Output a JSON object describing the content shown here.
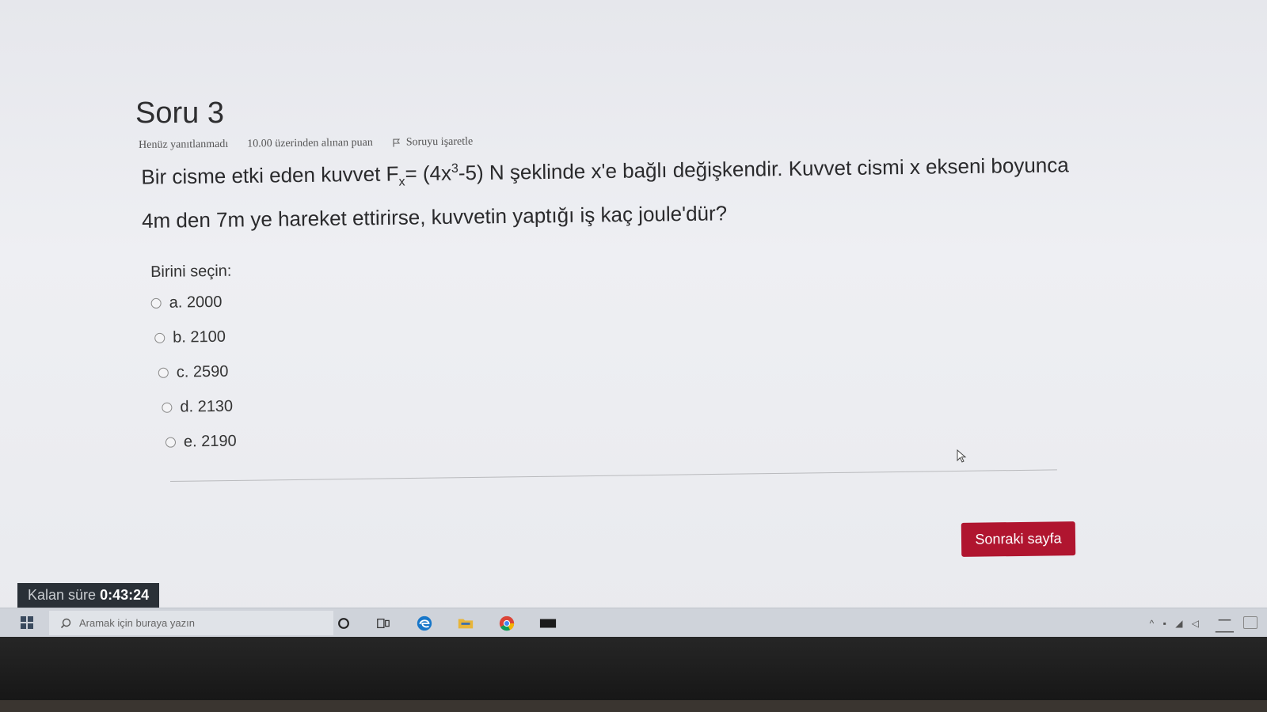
{
  "question": {
    "title": "Soru 3",
    "status": "Henüz yanıtlanmadı",
    "grade_info": "10.00 üzerinden alınan puan",
    "flag_label": "Soruyu işaretle",
    "text_part1": "Bir cisme etki eden kuvvet F",
    "text_sub": "x",
    "text_part2": "= (4x",
    "text_sup": "3",
    "text_part3": "-5) N şeklinde x'e bağlı değişkendir. Kuvvet cismi x ekseni boyunca 4m den 7m ye hareket ettirirse, kuvvetin yaptığı iş kaç joule'dür?"
  },
  "answer": {
    "prompt": "Birini seçin:",
    "options": [
      {
        "label": "a. 2000"
      },
      {
        "label": "b. 2100"
      },
      {
        "label": "c. 2590"
      },
      {
        "label": "d. 2130"
      },
      {
        "label": "e. 2190"
      }
    ]
  },
  "navigation": {
    "next_label": "Sonraki sayfa"
  },
  "timer": {
    "label": "Kalan süre",
    "value": "0:43:24"
  },
  "taskbar": {
    "search_placeholder": "Aramak için buraya yazın",
    "icons": [
      "start-icon",
      "cortana-icon",
      "task-view-icon",
      "edge-icon",
      "file-explorer-icon",
      "chrome-icon",
      "terminal-icon"
    ]
  },
  "colors": {
    "next_button": "#b0152f",
    "timer_bg": "#2a3037",
    "taskbar_bg": "#cfd3da"
  }
}
